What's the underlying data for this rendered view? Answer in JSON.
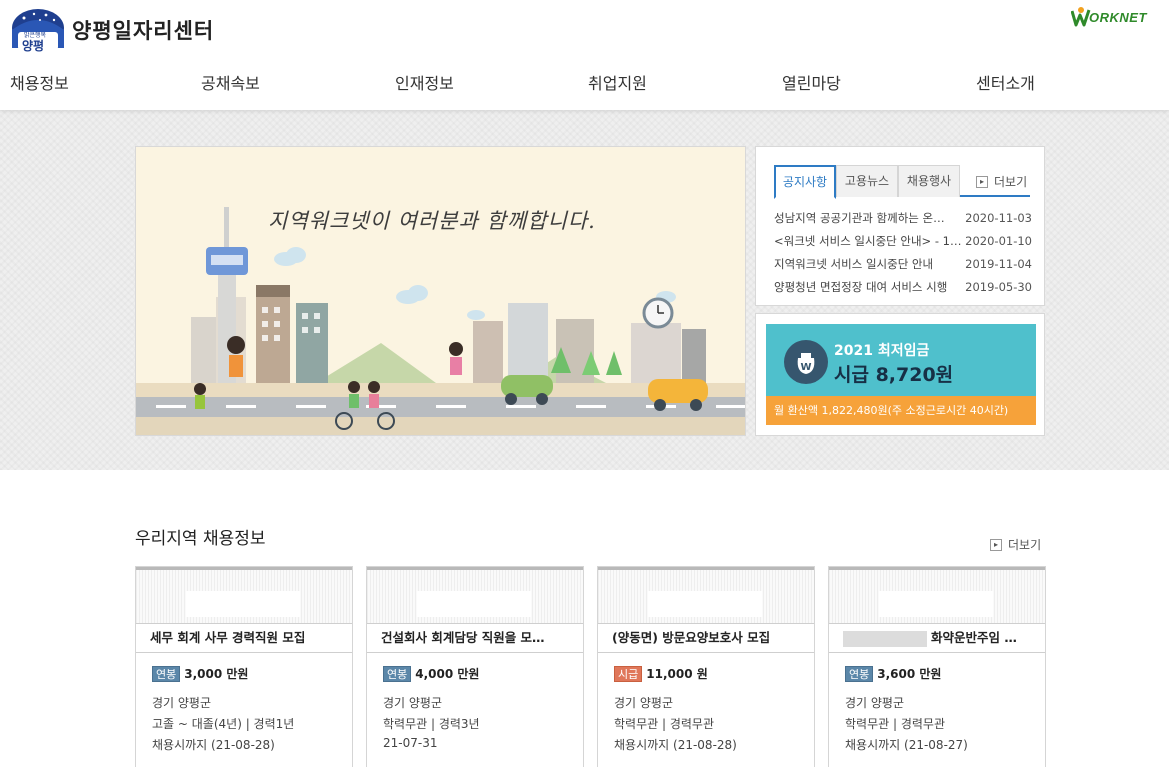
{
  "header": {
    "logo_badge_top": "맑은행복",
    "logo_badge_main": "양평",
    "site_name": "양평일자리센터",
    "worknet_label": "ORKNET"
  },
  "nav": [
    {
      "label": "채용정보"
    },
    {
      "label": "공채속보"
    },
    {
      "label": "인재정보"
    },
    {
      "label": "취업지원"
    },
    {
      "label": "열린마당"
    },
    {
      "label": "센터소개"
    }
  ],
  "banner": {
    "headline": "지역워크넷이 여러분과 함께합니다."
  },
  "notice_board": {
    "tabs": [
      {
        "label": "공지사항",
        "active": true
      },
      {
        "label": "고용뉴스",
        "active": false
      },
      {
        "label": "채용행사",
        "active": false
      }
    ],
    "more_label": "더보기",
    "items": [
      {
        "title": "성남지역 공공기관과 함께하는 온…",
        "date": "2020-11-03"
      },
      {
        "title": "<워크넷 서비스 일시중단 안내> - 1…",
        "date": "2020-01-10"
      },
      {
        "title": "지역워크넷 서비스 일시중단 안내",
        "date": "2019-11-04"
      },
      {
        "title": "양평청년 면접정장 대여 서비스 시행",
        "date": "2019-05-30"
      }
    ]
  },
  "min_wage": {
    "year_label": "2021 최저임금",
    "amount_label": "시급 8,720원",
    "monthly_label": "월 환산액 1,822,480원(주 소정근로시간 40시간)"
  },
  "jobs": {
    "section_title": "우리지역 채용정보",
    "more_label": "더보기",
    "cards": [
      {
        "title": "세무 회계 사무 경력직원 모집",
        "masked_company": false,
        "pay_type": "연봉",
        "pay_type_hourly": false,
        "pay_amount": "3,000 만원",
        "location": "경기 양평군",
        "requirements": "고졸 ~ 대졸(4년) | 경력1년",
        "deadline": "채용시까지 (21-08-28)"
      },
      {
        "title": "건설회사 회계담당 직원을 모…",
        "masked_company": false,
        "pay_type": "연봉",
        "pay_type_hourly": false,
        "pay_amount": "4,000 만원",
        "location": "경기 양평군",
        "requirements": "학력무관 | 경력3년",
        "deadline": "21-07-31"
      },
      {
        "title": "(양동면) 방문요양보호사 모집",
        "masked_company": false,
        "pay_type": "시급",
        "pay_type_hourly": true,
        "pay_amount": "11,000 원",
        "location": "경기 양평군",
        "requirements": "학력무관 | 경력무관",
        "deadline": "채용시까지 (21-08-28)"
      },
      {
        "title": "화약운반주임 …",
        "masked_company": true,
        "pay_type": "연봉",
        "pay_type_hourly": false,
        "pay_amount": "3,600 만원",
        "location": "경기 양평군",
        "requirements": "학력무관 | 경력무관",
        "deadline": "채용시까지 (21-08-27)"
      }
    ]
  }
}
